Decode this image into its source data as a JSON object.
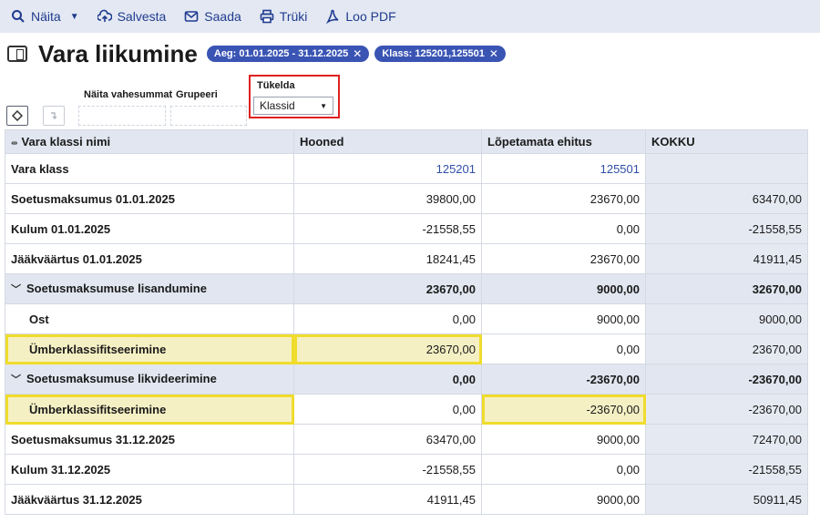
{
  "toolbar": {
    "naita": "Näita",
    "salvesta": "Salvesta",
    "saada": "Saada",
    "truki": "Trüki",
    "loo_pdf": "Loo PDF"
  },
  "title": "Vara liikumine",
  "chips": [
    "Aeg: 01.01.2025 - 31.12.2025",
    "Klass: 125201,125501"
  ],
  "controls": {
    "vahesummad_label": "Näita vahesummat",
    "grupeeri_label": "Grupeeri",
    "tukelda_label": "Tükelda",
    "tukelda_value": "Klassid"
  },
  "table": {
    "headers": [
      "Vara klassi nimi",
      "Hooned",
      "Lõpetamata ehitus",
      "KOKKU"
    ],
    "rows": [
      {
        "name": "Vara klass",
        "c1": "125201",
        "c2": "125501",
        "c3": ""
      },
      {
        "name": "Soetusmaksumus 01.01.2025",
        "c1": "39800,00",
        "c2": "23670,00",
        "c3": "63470,00"
      },
      {
        "name": "Kulum 01.01.2025",
        "c1": "-21558,55",
        "c2": "0,00",
        "c3": "-21558,55"
      },
      {
        "name": "Jääkväärtus 01.01.2025",
        "c1": "18241,45",
        "c2": "23670,00",
        "c3": "41911,45"
      },
      {
        "name": "Soetusmaksumuse lisandumine",
        "c1": "23670,00",
        "c2": "9000,00",
        "c3": "32670,00"
      },
      {
        "name": "Ost",
        "c1": "0,00",
        "c2": "9000,00",
        "c3": "9000,00"
      },
      {
        "name": "Ümberklassifitseerimine",
        "c1": "23670,00",
        "c2": "0,00",
        "c3": "23670,00"
      },
      {
        "name": "Soetusmaksumuse likvideerimine",
        "c1": "0,00",
        "c2": "-23670,00",
        "c3": "-23670,00"
      },
      {
        "name": "Ümberklassifitseerimine",
        "c1": "0,00",
        "c2": "-23670,00",
        "c3": "-23670,00"
      },
      {
        "name": "Soetusmaksumus 31.12.2025",
        "c1": "63470,00",
        "c2": "9000,00",
        "c3": "72470,00"
      },
      {
        "name": "Kulum 31.12.2025",
        "c1": "-21558,55",
        "c2": "0,00",
        "c3": "-21558,55"
      },
      {
        "name": "Jääkväärtus 31.12.2025",
        "c1": "41911,45",
        "c2": "9000,00",
        "c3": "50911,45"
      }
    ]
  }
}
